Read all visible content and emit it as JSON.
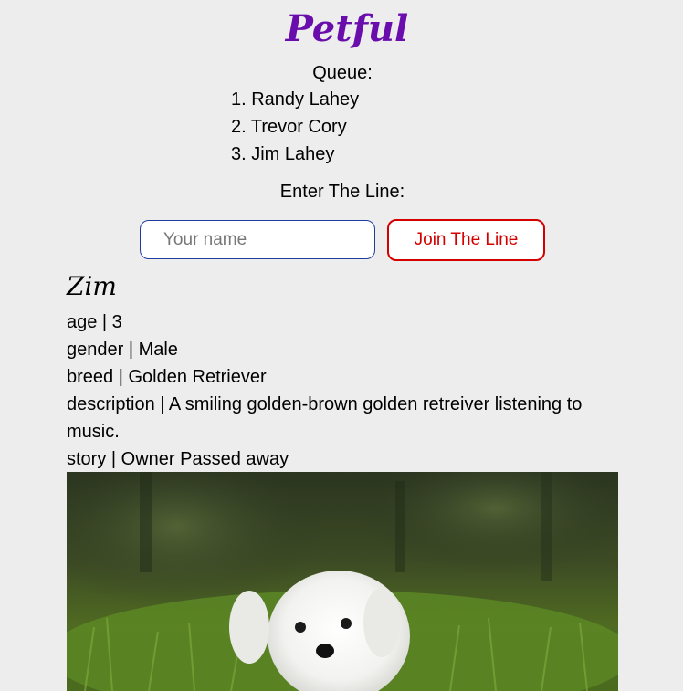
{
  "app": {
    "logo_text": "Petful"
  },
  "queue": {
    "label": "Queue:",
    "people": [
      "1. Randy Lahey",
      "2. Trevor Cory",
      "3. Jim Lahey"
    ]
  },
  "join": {
    "label": "Enter The Line:",
    "input_placeholder": "Your name",
    "input_value": "",
    "button_label": "Join The Line"
  },
  "pet": {
    "name": "Zim",
    "age": "age | 3",
    "gender": "gender | Male",
    "breed": "breed | Golden Retriever",
    "description": "description | A smiling golden-brown golden retreiver listening to music.",
    "story": "story | Owner Passed away",
    "photo_icon": "white-dog-photo"
  },
  "colors": {
    "background": "#ededed",
    "logo": "#6a0dad",
    "input_border": "#1e3c9e",
    "button_accent": "#d40000"
  }
}
